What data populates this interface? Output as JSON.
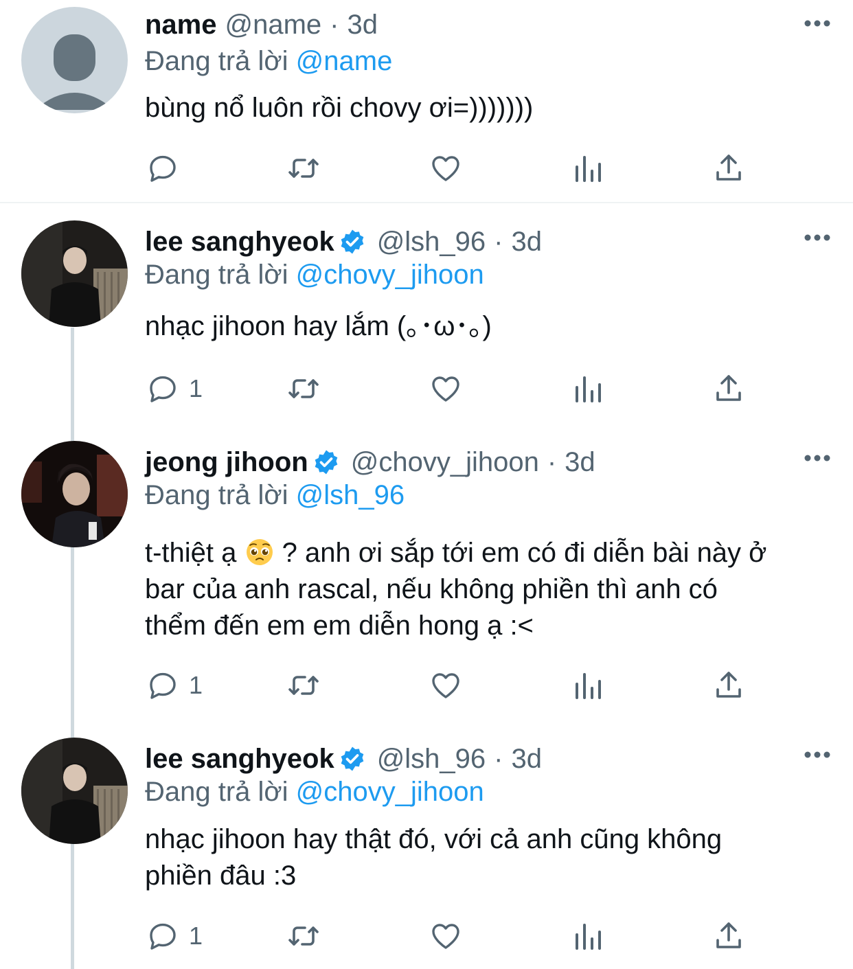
{
  "tweets": [
    {
      "display_name": "name",
      "handle": "@name",
      "time": "3d",
      "verified": false,
      "avatar": "default-avatar",
      "replying_prefix": "Đang trả lời",
      "replying_to": "@name",
      "text_lines": [
        "bùng nổ luôn rồi chovy ơi=)))))))"
      ],
      "reply_count": ""
    },
    {
      "display_name": "lee sanghyeok",
      "handle": "@lsh_96",
      "time": "3d",
      "verified": true,
      "avatar": "photo-avatar",
      "replying_prefix": "Đang trả lời",
      "replying_to": "@chovy_jihoon",
      "text_lines": [
        "nhạc jihoon hay lắm (｡･ω･｡)"
      ],
      "reply_count": "1"
    },
    {
      "display_name": "jeong jihoon",
      "handle": "@chovy_jihoon",
      "time": "3d",
      "verified": true,
      "avatar": "photo-avatar",
      "replying_prefix": "Đang trả lời",
      "replying_to": "@lsh_96",
      "text_lines": [
        "t-thiệt ạ",
        "? anh ơi sắp tới em có đi diễn bài này ở",
        "bar của anh rascal, nếu không phiền thì anh có",
        "thểm đến em em diễn hong ạ :<"
      ],
      "emoji": "pleading-face-emoji",
      "reply_count": "1"
    },
    {
      "display_name": "lee sanghyeok",
      "handle": "@lsh_96",
      "time": "3d",
      "verified": true,
      "avatar": "photo-avatar",
      "replying_prefix": "Đang trả lời",
      "replying_to": "@chovy_jihoon",
      "text_lines": [
        "nhạc jihoon hay thật đó, với cả anh cũng không",
        "phiền đâu :3"
      ],
      "reply_count": "1"
    }
  ],
  "separator": "·",
  "icons": [
    "reply-icon",
    "retweet-icon",
    "like-icon",
    "analytics-icon",
    "share-icon",
    "more-icon",
    "verified-badge-icon"
  ],
  "colors": {
    "accent": "#1d9bf0",
    "secondary_text": "#536471",
    "primary_text": "#0f1419",
    "thread_line": "#cfd9de",
    "divider": "#eff3f4"
  }
}
